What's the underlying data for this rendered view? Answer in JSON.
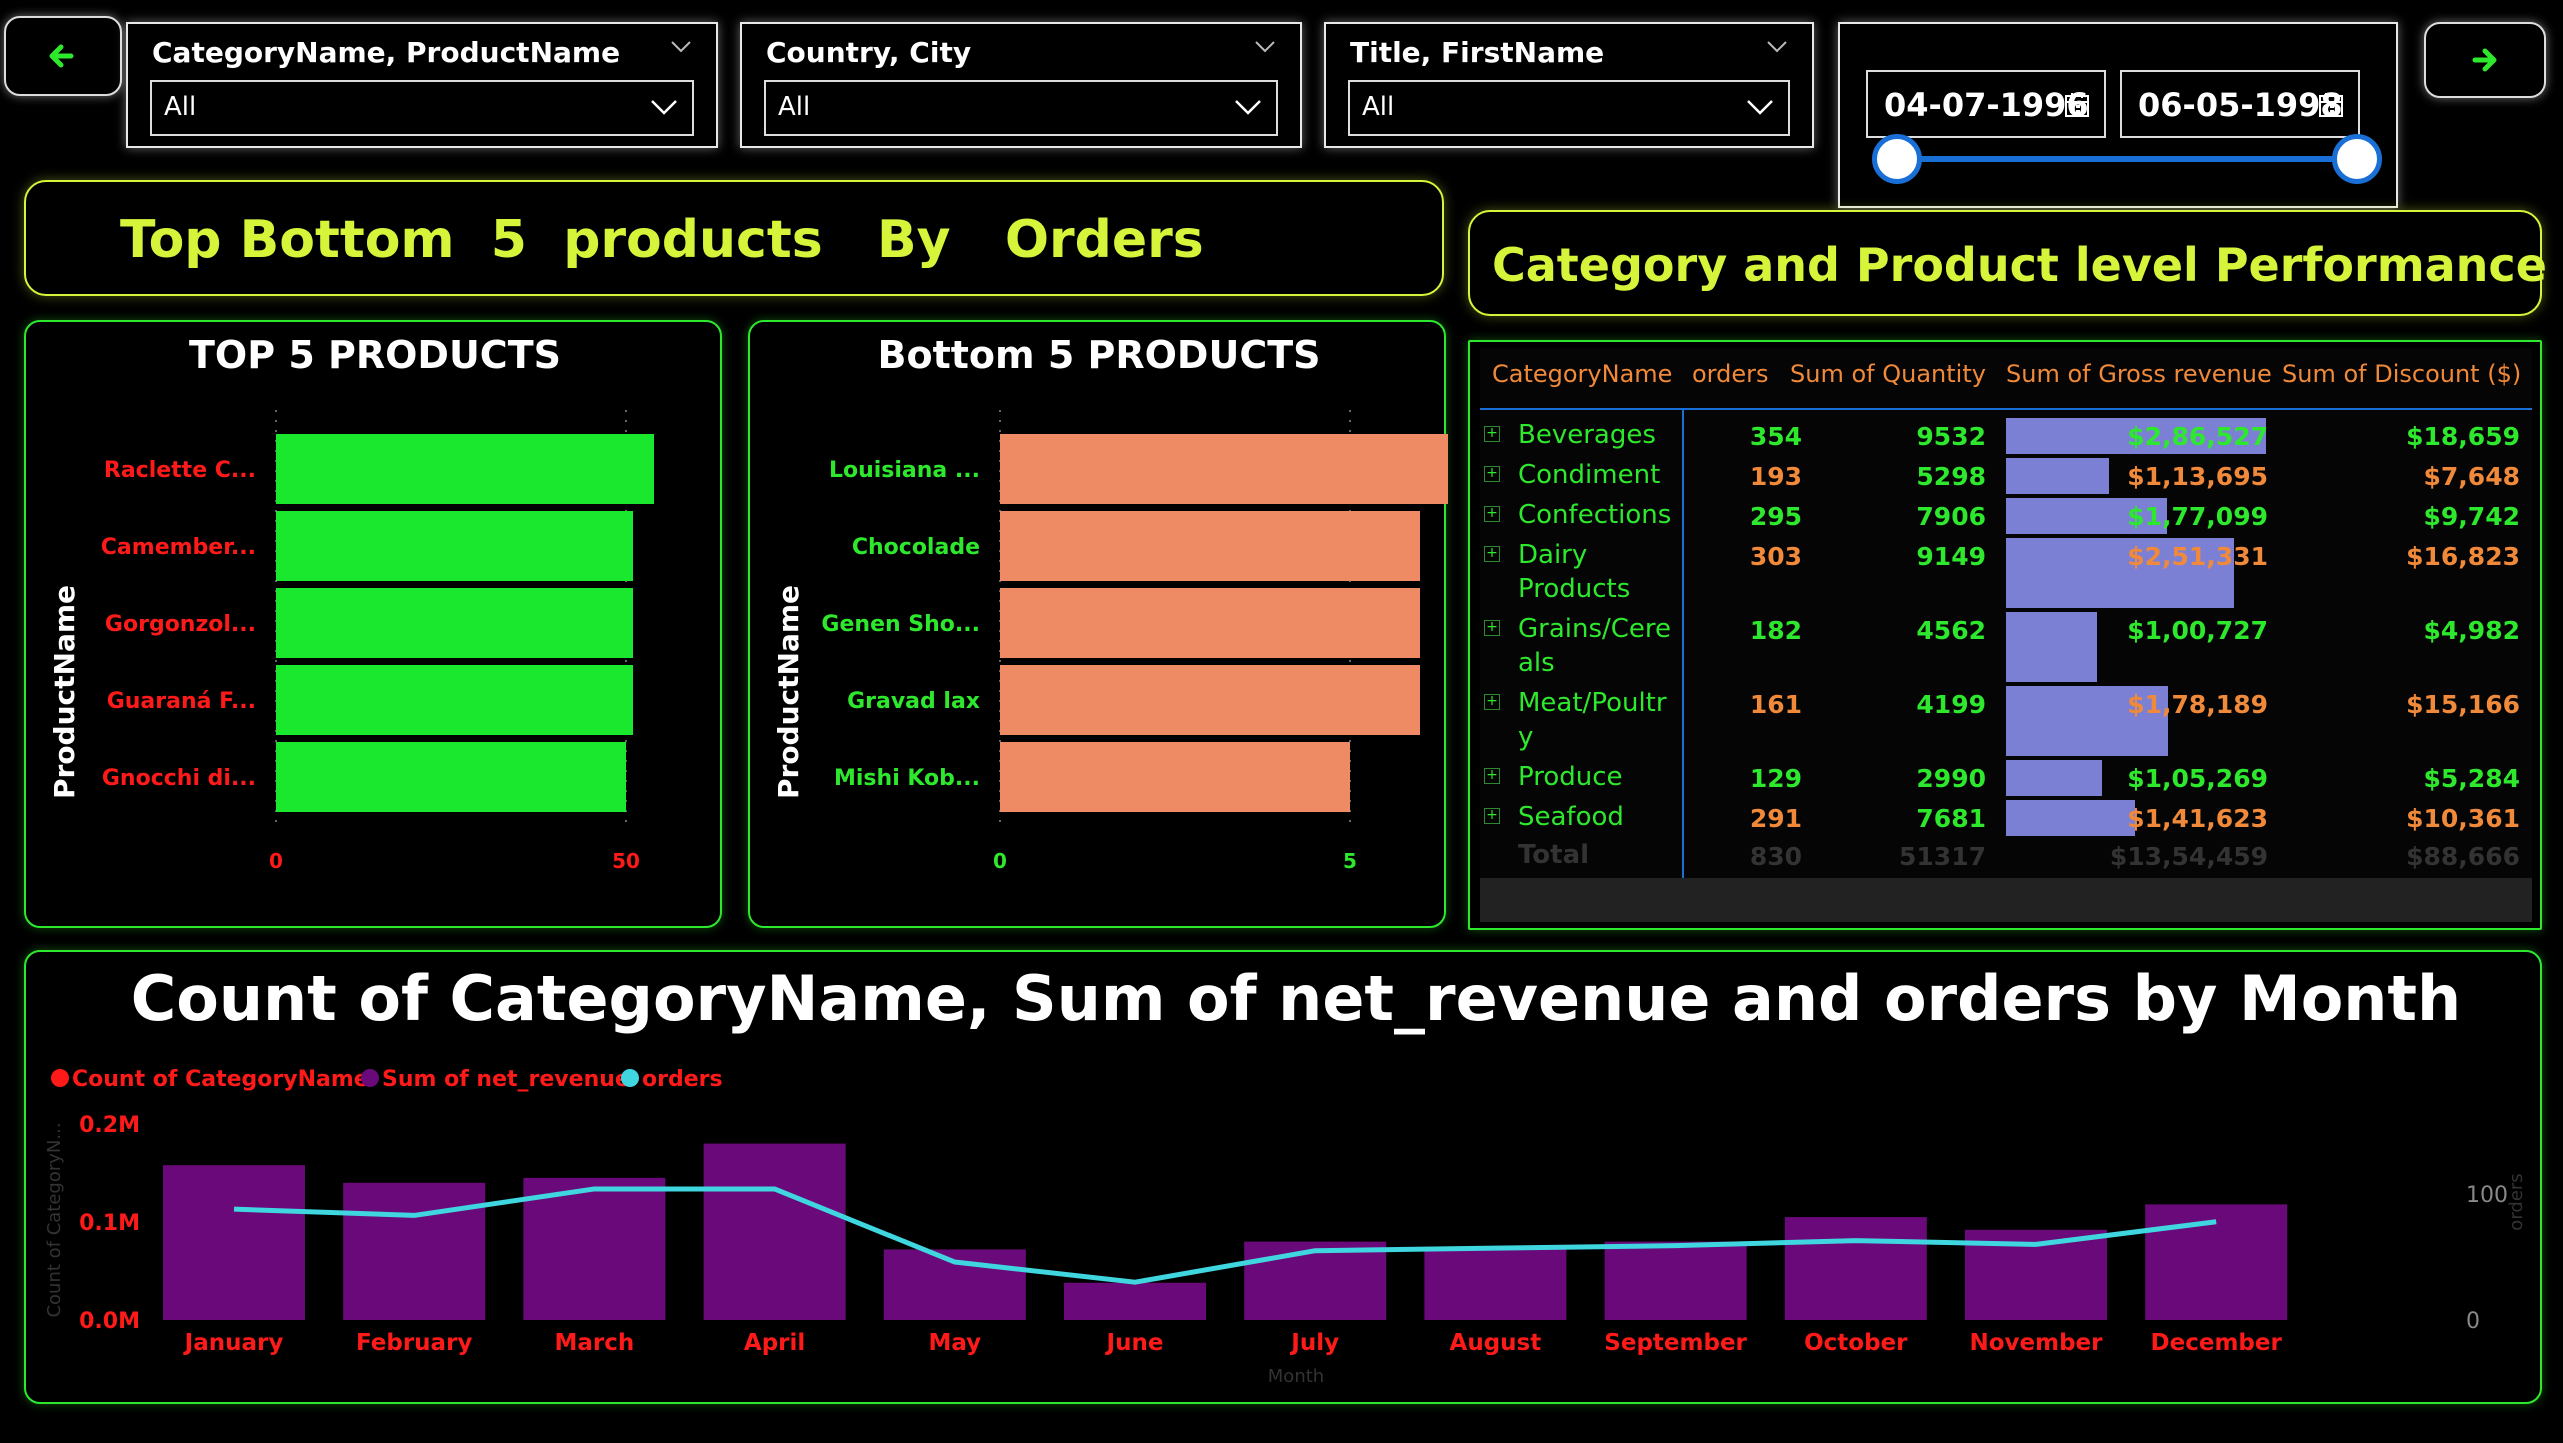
{
  "nav": {
    "back_icon": "arrow-left-icon",
    "forward_icon": "arrow-right-icon",
    "arrow_color": "#2ee82e"
  },
  "slicers": [
    {
      "title": "CategoryName, ProductName",
      "value": "All"
    },
    {
      "title": "Country, City",
      "value": "All"
    },
    {
      "title": "Title, FirstName",
      "value": "All"
    }
  ],
  "date_range": {
    "start": "04-07-1996",
    "end": "06-05-1998"
  },
  "left_title": "Top Bottom  5  products   By   Orders",
  "right_title": "Category and Product level Performance",
  "colors": {
    "accent_yellow": "#d6f53a",
    "green": "#2ee82e",
    "orange": "#ef8b64",
    "red": "#ff1a1a",
    "purple": "#6a0a7a",
    "cyan": "#3fd6e0",
    "databar": "#7b80d4"
  },
  "chart_data": [
    {
      "type": "bar",
      "orientation": "horizontal",
      "title": "TOP 5 PRODUCTS",
      "ylabel": "ProductName",
      "categories": [
        "Raclette C...",
        "Camember...",
        "Gorgonzol...",
        "Guaraná F...",
        "Gnocchi di..."
      ],
      "values": [
        54,
        51,
        51,
        51,
        50
      ],
      "xlim": [
        0,
        50
      ],
      "xticks": [
        "0",
        "50"
      ]
    },
    {
      "type": "bar",
      "orientation": "horizontal",
      "title": "Bottom 5 PRODUCTS",
      "ylabel": "ProductName",
      "categories": [
        "Louisiana ...",
        "Chocolade",
        "Genen Sho...",
        "Gravad lax",
        "Mishi Kob..."
      ],
      "values": [
        8,
        6,
        6,
        6,
        5
      ],
      "xlim": [
        0,
        5
      ],
      "xticks": [
        "0",
        "5"
      ]
    },
    {
      "type": "table",
      "columns": [
        "CategoryName",
        "orders",
        "Sum of Quantity",
        "Sum of Gross revenue",
        "Sum of Discount ($)"
      ],
      "rows": [
        {
          "name": "Beverages",
          "orders": "354",
          "quantity": "9532",
          "gross": "$2,86,527",
          "gross_value": 286527,
          "discount": "$18,659"
        },
        {
          "name": "Condiment",
          "orders": "193",
          "quantity": "5298",
          "gross": "$1,13,695",
          "gross_value": 113695,
          "discount": "$7,648"
        },
        {
          "name": "Confections",
          "orders": "295",
          "quantity": "7906",
          "gross": "$1,77,099",
          "gross_value": 177099,
          "discount": "$9,742"
        },
        {
          "name": "Dairy Products",
          "orders": "303",
          "quantity": "9149",
          "gross": "$2,51,331",
          "gross_value": 251331,
          "discount": "$16,823"
        },
        {
          "name": "Grains/Cereals",
          "orders": "182",
          "quantity": "4562",
          "gross": "$1,00,727",
          "gross_value": 100727,
          "discount": "$4,982"
        },
        {
          "name": "Meat/Poultry",
          "orders": "161",
          "quantity": "4199",
          "gross": "$1,78,189",
          "gross_value": 178189,
          "discount": "$15,166"
        },
        {
          "name": "Produce",
          "orders": "129",
          "quantity": "2990",
          "gross": "$1,05,269",
          "gross_value": 105269,
          "discount": "$5,284"
        },
        {
          "name": "Seafood",
          "orders": "291",
          "quantity": "7681",
          "gross": "$1,41,623",
          "gross_value": 141623,
          "discount": "$10,361"
        }
      ],
      "total": {
        "name": "Total",
        "orders": "830",
        "quantity": "51317",
        "gross": "$13,54,459",
        "discount": "$88,666"
      }
    },
    {
      "type": "bar",
      "combo": "bar+line",
      "title": "Count of CategoryName, Sum of net_revenue and orders by Month",
      "xlabel": "Month",
      "ylabel": "Count of CategoryN...",
      "y2label": "orders",
      "legend": [
        "Count of CategoryName",
        "Sum of net_revenue",
        "orders"
      ],
      "legend_colors": [
        "#ff1a1a",
        "#6a0a7a",
        "#3fd6e0"
      ],
      "categories": [
        "January",
        "February",
        "March",
        "April",
        "May",
        "June",
        "July",
        "August",
        "September",
        "October",
        "November",
        "December"
      ],
      "series": [
        {
          "name": "Sum of net_revenue",
          "type": "bar",
          "values": [
            158000,
            140000,
            145000,
            180000,
            72000,
            38000,
            80000,
            74000,
            80000,
            105000,
            92000,
            118000
          ]
        },
        {
          "name": "orders",
          "type": "line",
          "values": [
            88,
            83,
            104,
            104,
            46,
            30,
            55,
            57,
            59,
            63,
            60,
            78
          ]
        }
      ],
      "ylim": [
        0,
        200000
      ],
      "yticks": [
        "0.0M",
        "0.1M",
        "0.2M"
      ],
      "y2lim": [
        0,
        100
      ],
      "y2ticks": [
        "0",
        "100"
      ]
    }
  ]
}
